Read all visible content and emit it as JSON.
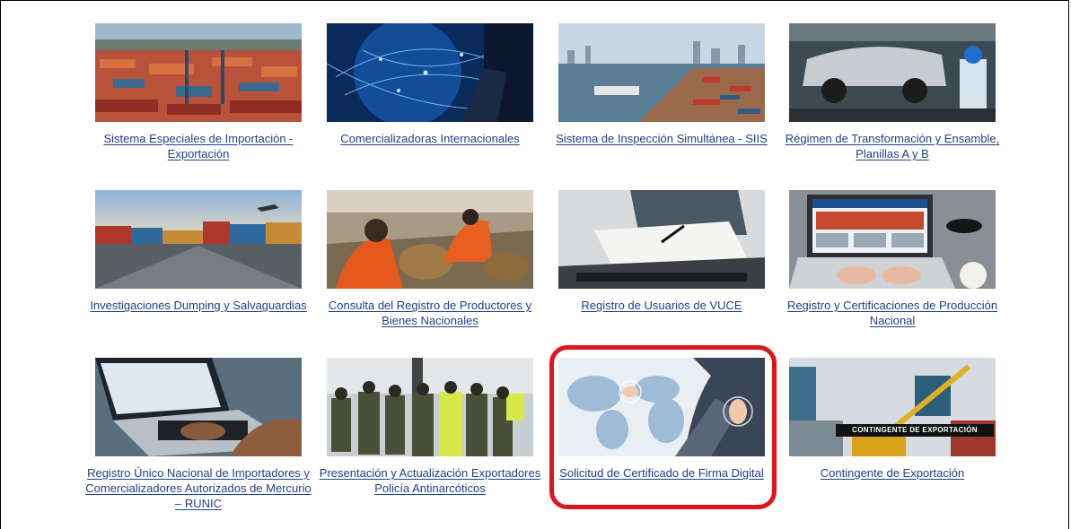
{
  "tiles": [
    {
      "label": "Sistema Especiales de Importación - Exportación"
    },
    {
      "label": "Comercializadoras Internacionales"
    },
    {
      "label": "Sistema de Inspección Simultánea - SIIS"
    },
    {
      "label": "Régimen de Transformación y Ensamble, Planillas A y B"
    },
    {
      "label": "Investigaciones Dumping y Salvaguardias"
    },
    {
      "label": "Consulta del Registro de Productores y Bienes Nacionales"
    },
    {
      "label": "Registro de Usuarios de VUCE"
    },
    {
      "label": "Registro y Certificaciones de Producción Nacional"
    },
    {
      "label": "Registro Único Nacional de Importadores y Comercializadores Autorizados de Mercurio – RUNIC"
    },
    {
      "label": "Presentación y Actualización Exportadores Policía Antinarcóticos"
    },
    {
      "label": "Solicitud de Certificado de Firma Digital"
    },
    {
      "label": "Contingente de Exportación",
      "image_overlay": "CONTINGENTE DE EXPORTACIÓN"
    }
  ],
  "colors": {
    "link": "#1f3f8a",
    "highlight": "#e0141b"
  }
}
